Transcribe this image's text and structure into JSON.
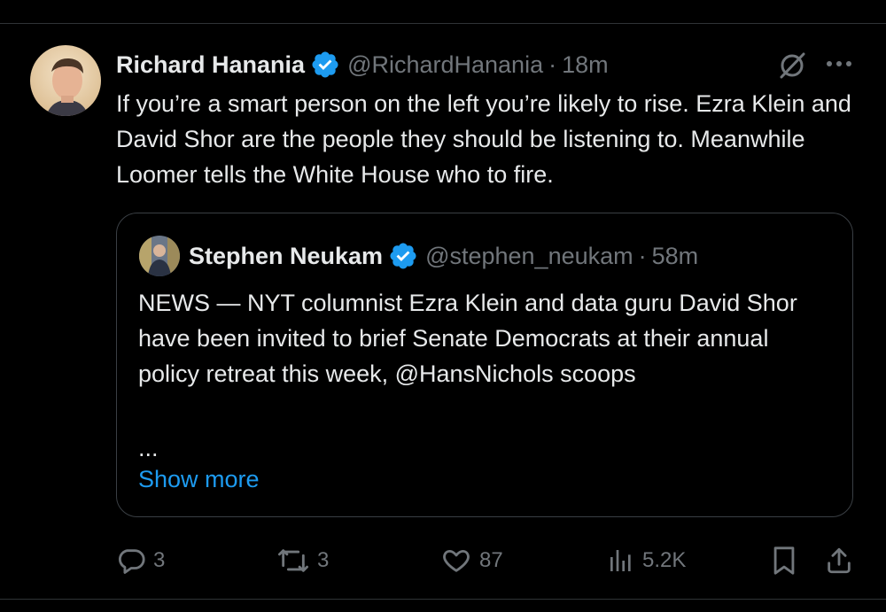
{
  "tweet": {
    "author_name": "Richard Hanania",
    "handle": "@RichardHanania",
    "separator": "·",
    "time": "18m",
    "text": "If you’re a smart person on the left you’re likely to rise. Ezra Klein and David Shor are the people they should be listening to. Meanwhile Loomer tells the White House who to fire."
  },
  "quote": {
    "author_name": "Stephen Neukam",
    "handle": "@stephen_neukam",
    "separator": "·",
    "time": "58m",
    "text": "NEWS — NYT columnist Ezra Klein and data guru David Shor have been invited to brief Senate Democrats at their annual policy retreat this week, @HansNichols scoops",
    "ellipsis": "...",
    "show_more": "Show more"
  },
  "actions": {
    "replies": "3",
    "reposts": "3",
    "likes": "87",
    "views": "5.2K"
  },
  "icons": {
    "verified": "verified-badge-icon",
    "grok": "grok-icon",
    "more": "more-icon",
    "reply": "reply-icon",
    "repost": "repost-icon",
    "like": "like-icon",
    "views": "views-icon",
    "bookmark": "bookmark-icon",
    "share": "share-icon"
  },
  "colors": {
    "background": "#000000",
    "text": "#e7e9ea",
    "muted": "#71767b",
    "accent": "#1d9bf0",
    "border": "#2f3336"
  }
}
